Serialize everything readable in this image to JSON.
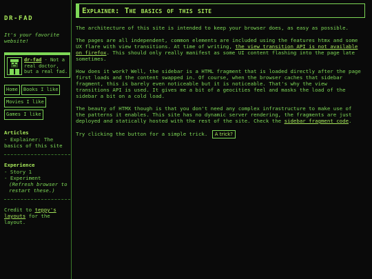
{
  "site": {
    "logo": "DR-FAD",
    "tagline": "It's your favorite website!"
  },
  "profile": {
    "name": "dr-fad",
    "desc": " - Not a real doctor, but a real fad."
  },
  "nav": [
    {
      "label": "Home"
    },
    {
      "label": "Books I like"
    },
    {
      "label": "Movies I like"
    },
    {
      "label": "Games I like"
    }
  ],
  "articles": {
    "title": "Articles",
    "items": [
      "- Explainer: The basics of this site"
    ]
  },
  "experience": {
    "title": "Experience",
    "items": [
      "- Story 1",
      "- Experiment"
    ],
    "note": "(Refresh browser to restart these.)"
  },
  "credit": {
    "prefix": "Credit to ",
    "link": "teppy's layouts",
    "suffix": " for the layout."
  },
  "main": {
    "title": "Explainer: The basics of this site",
    "p1": "The architecture of this site is intended to keep your browser does, as easy as possible.",
    "p2a": "The pages are all independent, common elements are included using the features htmx and some UX flare with view transitions. At time of writing, ",
    "p2link": "the view transition API is not available on firefox",
    "p2b": ". This should only really manifest as some UI content flashing into the page late sometimes.",
    "p3": "How does it work? Well, the sidebar is a HTML fragment that is loaded directly after the page first loads and the content swapped in. Of course, when the browser caches that sidebar fragment, this is barely even noticeable but it is noticeable. That's why the view transitions API is used. It gives me a bit of a geocities feel and masks the load of the sidebar a bit on a cold load.",
    "p4a": "The beauty of HTMX though is that you don't need any complex infrastructure to make use of the patterns it enables. This site has no dynamic server rendering, the fragments are just deployed and statically hosted with the rest of the site. Check the ",
    "p4link": "sidebar fragment code",
    "p4b": ".",
    "p5": "Try clicking the button for a simple trick.",
    "button": "A trick?"
  },
  "colors": {
    "accent": "#7ed957",
    "bright": "#a7e85a",
    "bg": "#0a0a0a"
  },
  "icons": {
    "avatar": "avatar-icon"
  }
}
